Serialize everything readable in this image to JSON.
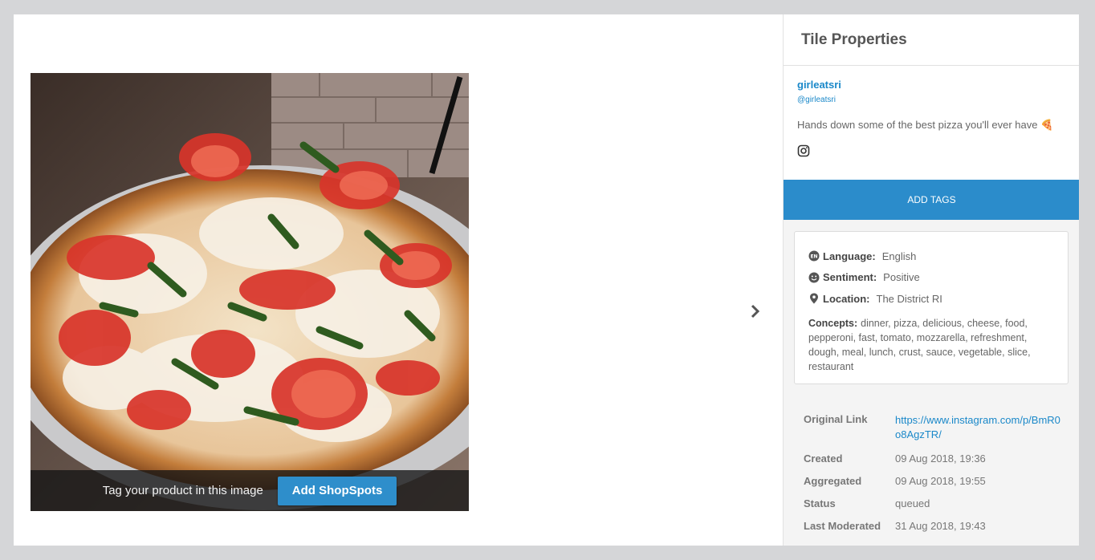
{
  "media": {
    "overlay_text": "Tag your product in this image",
    "shopspots_button": "Add ShopSpots",
    "next_icon": "chevron-right-icon"
  },
  "panel": {
    "title": "Tile Properties",
    "user": {
      "name": "girleatsri",
      "handle": "@girleatsri",
      "caption": "Hands down some of the best pizza you'll ever have 🍕",
      "source_icon": "instagram-icon"
    },
    "add_tags_button": "ADD TAGS",
    "analysis": {
      "language_label": "Language:",
      "language_value": "English",
      "sentiment_label": "Sentiment:",
      "sentiment_value": "Positive",
      "location_label": "Location:",
      "location_value": "The District RI",
      "concepts_label": "Concepts:",
      "concepts_value": "dinner, pizza, delicious, cheese, food, pepperoni, fast, tomato, mozzarella, refreshment, dough, meal, lunch, crust, sauce, vegetable, slice, restaurant"
    },
    "meta": [
      {
        "key": "Original Link",
        "value": "https://www.instagram.com/p/BmR0o8AgzTR/"
      },
      {
        "key": "Created",
        "value": "09 Aug 2018, 19:36"
      },
      {
        "key": "Aggregated",
        "value": "09 Aug 2018, 19:55"
      },
      {
        "key": "Status",
        "value": "queued"
      },
      {
        "key": "Last Moderated",
        "value": "31 Aug 2018, 19:43"
      }
    ]
  },
  "colors": {
    "accent": "#2b8ccb",
    "link": "#1a88c9",
    "backdrop": "#d5d6d8"
  }
}
